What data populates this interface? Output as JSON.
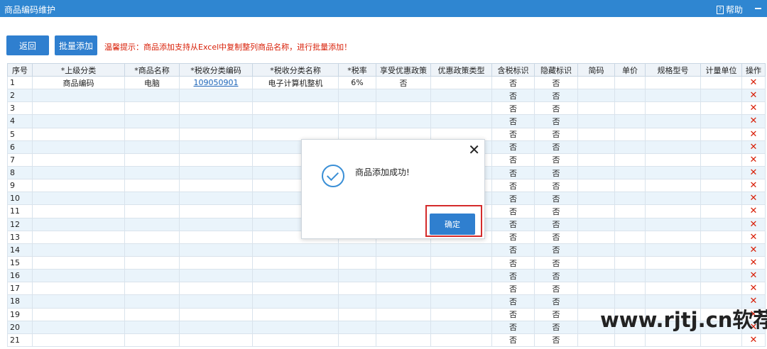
{
  "window": {
    "title": "商品编码维护",
    "help_label": "帮助"
  },
  "toolbar": {
    "back_label": "返回",
    "batch_add_label": "批量添加",
    "hint": "温馨提示：商品添加支持从Excel中复制整列商品名称，进行批量添加！"
  },
  "table": {
    "headers": [
      "序号",
      "*上级分类",
      "*商品名称",
      "*税收分类编码",
      "*税收分类名称",
      "*税率",
      "享受优惠政策",
      "优惠政策类型",
      "含税标识",
      "隐藏标识",
      "简码",
      "单价",
      "规格型号",
      "计量单位",
      "操作"
    ],
    "rows": [
      {
        "seq": "1",
        "parent_category": "商品编码",
        "product_name": "电脑",
        "tax_code": "109050901",
        "tax_name": "电子计算机整机",
        "tax_rate": "6%",
        "preferential": "否",
        "policy_type": "",
        "tax_included": "否",
        "hidden": "否",
        "short_code": "",
        "unit_price": "",
        "spec": "",
        "unit": ""
      },
      {
        "seq": "2",
        "tax_included": "否",
        "hidden": "否"
      },
      {
        "seq": "3",
        "tax_included": "否",
        "hidden": "否"
      },
      {
        "seq": "4",
        "tax_included": "否",
        "hidden": "否"
      },
      {
        "seq": "5",
        "tax_included": "否",
        "hidden": "否"
      },
      {
        "seq": "6",
        "tax_included": "否",
        "hidden": "否"
      },
      {
        "seq": "7",
        "tax_included": "否",
        "hidden": "否"
      },
      {
        "seq": "8",
        "tax_included": "否",
        "hidden": "否"
      },
      {
        "seq": "9",
        "tax_included": "否",
        "hidden": "否"
      },
      {
        "seq": "10",
        "tax_included": "否",
        "hidden": "否"
      },
      {
        "seq": "11",
        "tax_included": "否",
        "hidden": "否"
      },
      {
        "seq": "12",
        "tax_included": "否",
        "hidden": "否"
      },
      {
        "seq": "13",
        "tax_included": "否",
        "hidden": "否"
      },
      {
        "seq": "14",
        "tax_included": "否",
        "hidden": "否"
      },
      {
        "seq": "15",
        "tax_included": "否",
        "hidden": "否"
      },
      {
        "seq": "16",
        "tax_included": "否",
        "hidden": "否"
      },
      {
        "seq": "17",
        "tax_included": "否",
        "hidden": "否"
      },
      {
        "seq": "18",
        "tax_included": "否",
        "hidden": "否"
      },
      {
        "seq": "19",
        "tax_included": "否",
        "hidden": "否"
      },
      {
        "seq": "20",
        "tax_included": "否",
        "hidden": "否"
      },
      {
        "seq": "21",
        "tax_included": "否",
        "hidden": "否"
      }
    ],
    "delete_icon": "close-icon"
  },
  "dialog": {
    "message": "商品添加成功!",
    "confirm_label": "确定",
    "close_icon": "close-icon",
    "status_icon": "check-circle-icon"
  },
  "watermark": "www.rjtj.cn软荐网",
  "colors": {
    "titlebar": "#2f86d1",
    "button": "#2f7fcf",
    "hint": "#d81e06",
    "delete": "#d81e06",
    "highlight_frame": "#d42b2b",
    "row_alt": "#eaf4fb"
  }
}
